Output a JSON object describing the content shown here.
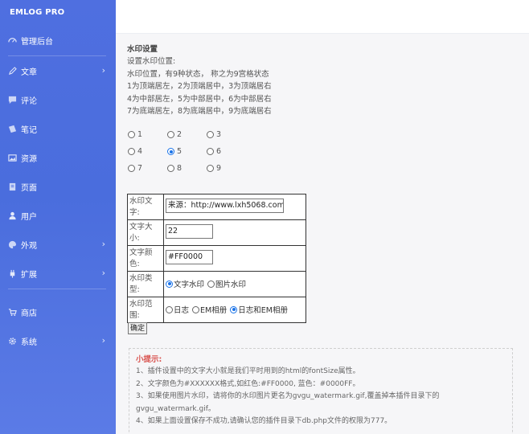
{
  "brand": "EMLOG PRO",
  "sidebar": {
    "items": [
      {
        "label": "管理后台",
        "icon": "dashboard-icon"
      },
      {
        "label": "文章",
        "icon": "pencil-icon",
        "arrow": true
      },
      {
        "label": "评论",
        "icon": "comment-icon"
      },
      {
        "label": "笔记",
        "icon": "note-icon"
      },
      {
        "label": "资源",
        "icon": "image-icon"
      },
      {
        "label": "页面",
        "icon": "page-icon"
      },
      {
        "label": "用户",
        "icon": "user-icon"
      },
      {
        "label": "外观",
        "icon": "palette-icon",
        "arrow": true
      },
      {
        "label": "扩展",
        "icon": "plugin-icon",
        "arrow": true
      },
      {
        "label": "商店",
        "icon": "cart-icon"
      },
      {
        "label": "系统",
        "icon": "gear-icon",
        "arrow": true
      }
    ],
    "arrow_glyph": "›"
  },
  "settings": {
    "title": "水印设置",
    "lines": [
      "设置水印位置:",
      "水印位置，有9种状态，  称之为9宫格状态",
      "1为顶端居左，2为顶端居中，3为顶端居右",
      "4为中部居左，5为中部居中，6为中部居右",
      "7为底端居左，8为底端居中，9为底端居右"
    ],
    "positions": [
      "1",
      "2",
      "3",
      "4",
      "5",
      "6",
      "7",
      "8",
      "9"
    ],
    "selected_position": "5"
  },
  "form": {
    "text_label": "水印文字:",
    "text_value": "来源：http://www.lxh5068.com/",
    "size_label": "文字大小:",
    "size_value": "22",
    "color_label": "文字颜色:",
    "color_value": "#FF0000",
    "type_label": "水印类型:",
    "type_options": [
      "文字水印",
      "图片水印"
    ],
    "type_selected": "文字水印",
    "range_label": "水印范围:",
    "range_options": [
      "日志",
      "EM相册",
      "日志和EM相册"
    ],
    "range_selected": "日志和EM相册",
    "submit_label": "确定"
  },
  "tips": {
    "title": "小提示:",
    "lines": [
      "1、插件设置中的文字大小就是我们平时用到的html的fontSize属性。",
      "2、文字颜色为#XXXXXX格式,如红色:#FF0000, 蓝色：#0000FF。",
      "3、如果使用图片水印，请将你的水印图片更名为gvgu_watermark.gif,覆盖掉本插件目录下的",
      "gvgu_watermark.gif。",
      "4、如果上面设置保存不成功,请确认您的插件目录下db.php文件的权限为777。"
    ]
  },
  "colors": {
    "sidebar": "#4f6fe0",
    "accent": "#1a73e8",
    "tip_title": "#d9534f"
  }
}
